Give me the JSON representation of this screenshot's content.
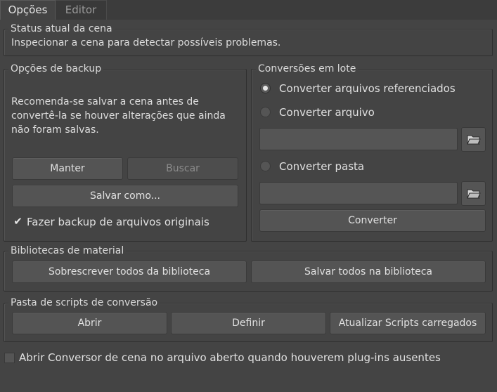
{
  "tabs": [
    {
      "label": "Opções",
      "active": true
    },
    {
      "label": "Editor",
      "active": false
    }
  ],
  "status": {
    "title": "Status atual da cena",
    "text": "Inspecionar a cena para detectar possíveis problemas."
  },
  "backup": {
    "title": "Opções de backup",
    "text_lines": [
      "Recomenda-se salvar a cena antes de",
      "convertê-la se houver alterações que ainda",
      "não foram salvas."
    ],
    "keep_label": "Manter",
    "browse_label": "Buscar",
    "save_as_label": "Salvar como...",
    "backup_checkbox_label": "Fazer backup de arquivos originais",
    "backup_checked": true
  },
  "batch": {
    "title": "Conversões em lote",
    "radio_referenced": "Converter arquivos referenciados",
    "radio_file": "Converter arquivo",
    "radio_folder": "Converter pasta",
    "selected": "referenced",
    "file_value": "",
    "folder_value": "",
    "convert_label": "Converter"
  },
  "libraries": {
    "title": "Bibliotecas de material",
    "overwrite_label": "Sobrescrever todos da biblioteca",
    "save_all_label": "Salvar todos na biblioteca"
  },
  "scripts": {
    "title": "Pasta de scripts de conversão",
    "open_label": "Abrir",
    "define_label": "Definir",
    "update_label": "Atualizar Scripts carregados"
  },
  "bottom": {
    "open_converter_label": "Abrir Conversor de cena no arquivo aberto quando houverem plug-ins ausentes",
    "checked": false
  },
  "icons": {
    "folder": "folder-icon",
    "check": "check-icon"
  }
}
